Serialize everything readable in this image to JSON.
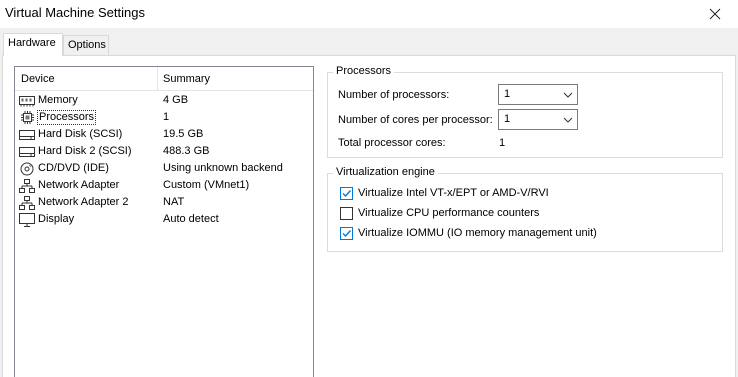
{
  "window": {
    "title": "Virtual Machine Settings"
  },
  "tabs": [
    {
      "label": "Hardware",
      "active": true
    },
    {
      "label": "Options",
      "active": false
    }
  ],
  "device_list": {
    "columns": [
      "Device",
      "Summary"
    ],
    "rows": [
      {
        "device": "Memory",
        "summary": "4 GB",
        "icon": "memory-icon"
      },
      {
        "device": "Processors",
        "summary": "1",
        "icon": "processor-icon",
        "selected": true
      },
      {
        "device": "Hard Disk (SCSI)",
        "summary": "19.5 GB",
        "icon": "hard-disk-icon"
      },
      {
        "device": "Hard Disk 2 (SCSI)",
        "summary": "488.3 GB",
        "icon": "hard-disk-icon"
      },
      {
        "device": "CD/DVD (IDE)",
        "summary": "Using unknown backend",
        "icon": "cd-dvd-icon"
      },
      {
        "device": "Network Adapter",
        "summary": "Custom (VMnet1)",
        "icon": "network-adapter-icon"
      },
      {
        "device": "Network Adapter 2",
        "summary": "NAT",
        "icon": "network-adapter-icon"
      },
      {
        "device": "Display",
        "summary": "Auto detect",
        "icon": "display-icon"
      }
    ]
  },
  "processors": {
    "legend": "Processors",
    "num_processors_label": "Number of processors:",
    "num_processors_value": "1",
    "cores_label": "Number of cores per processor:",
    "cores_value": "1",
    "total_label": "Total processor cores:",
    "total_value": "1"
  },
  "virtualization": {
    "legend": "Virtualization engine",
    "options": [
      {
        "label": "Virtualize Intel VT-x/EPT or AMD-V/RVI",
        "checked": true
      },
      {
        "label": "Virtualize CPU performance counters",
        "checked": false
      },
      {
        "label": "Virtualize IOMMU (IO memory management unit)",
        "checked": true
      }
    ]
  },
  "colors": {
    "accent": "#0078d7",
    "border": "#dcdcdc",
    "tab_bg": "#f0f0f0"
  }
}
